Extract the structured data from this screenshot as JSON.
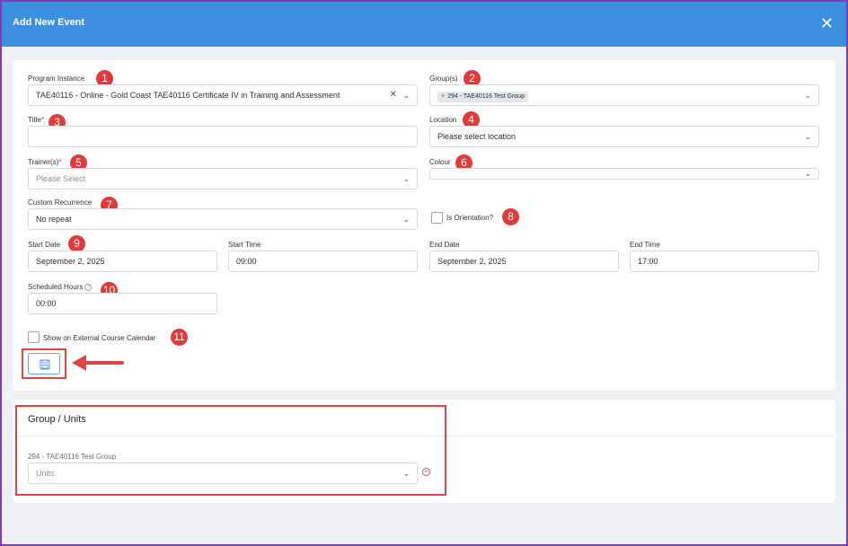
{
  "dialog": {
    "title": "Add New Event",
    "close_glyph": "✕"
  },
  "fields": {
    "program_instance": {
      "label": "Program Instance",
      "value": "TAE40116 - Online - Gold Coast TAE40116 Certificate IV in Training and Assessment"
    },
    "groups": {
      "label": "Group(s)",
      "tag": "294 - TAE40116 Test Group"
    },
    "title": {
      "label": "Title",
      "required_mark": "*",
      "value": ""
    },
    "location": {
      "label": "Location",
      "placeholder": "Please select location"
    },
    "trainers": {
      "label": "Trainer(s)",
      "required_mark": "*",
      "placeholder": "Please Select"
    },
    "colour": {
      "label": "Colour",
      "value": ""
    },
    "custom_recurrence": {
      "label": "Custom Recurrence",
      "value": "No repeat"
    },
    "is_orientation": {
      "label": "Is Orientation?",
      "checked": false
    },
    "start_date": {
      "label": "Start Date",
      "value": "September 2, 2025"
    },
    "start_time": {
      "label": "Start Time",
      "value": "09:00"
    },
    "end_date": {
      "label": "End Date",
      "value": "September 2, 2025"
    },
    "end_time": {
      "label": "End Time",
      "value": "17:00"
    },
    "scheduled_hours": {
      "label": "Scheduled Hours",
      "value": "00:00",
      "help_glyph": "?"
    },
    "show_external": {
      "label": "Show on External Course Calendar",
      "checked": false
    }
  },
  "save_button": {
    "icon": "floppy-disk-icon"
  },
  "units_section": {
    "title": "Group / Units",
    "group_label": "294 - TAE40116 Test Group",
    "units_placeholder": "Units",
    "remove_glyph": "×"
  },
  "callouts": [
    "1",
    "2",
    "3",
    "4",
    "5",
    "6",
    "7",
    "8",
    "9",
    "10",
    "11"
  ],
  "colors": {
    "header": "#3d8fe0",
    "callout": "#e23a3a",
    "highlight": "#e04545",
    "frame": "#7b3fb0"
  }
}
